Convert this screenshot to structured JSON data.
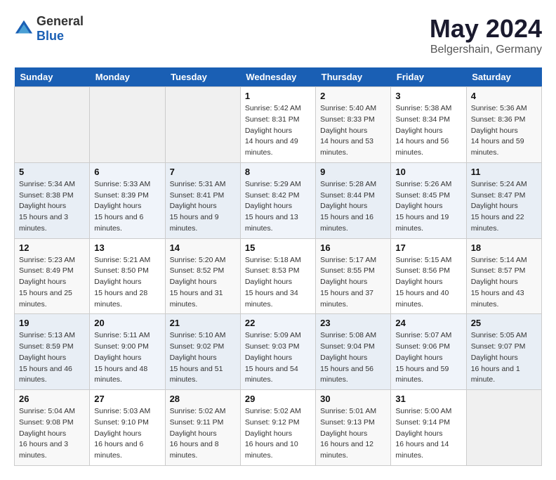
{
  "header": {
    "logo": {
      "general": "General",
      "blue": "Blue"
    },
    "title": "May 2024",
    "location": "Belgershain, Germany"
  },
  "calendar": {
    "weekdays": [
      "Sunday",
      "Monday",
      "Tuesday",
      "Wednesday",
      "Thursday",
      "Friday",
      "Saturday"
    ],
    "weeks": [
      [
        {
          "day": null,
          "info": null
        },
        {
          "day": null,
          "info": null
        },
        {
          "day": null,
          "info": null
        },
        {
          "day": "1",
          "sunrise": "5:42 AM",
          "sunset": "8:31 PM",
          "daylight": "14 hours and 49 minutes."
        },
        {
          "day": "2",
          "sunrise": "5:40 AM",
          "sunset": "8:33 PM",
          "daylight": "14 hours and 53 minutes."
        },
        {
          "day": "3",
          "sunrise": "5:38 AM",
          "sunset": "8:34 PM",
          "daylight": "14 hours and 56 minutes."
        },
        {
          "day": "4",
          "sunrise": "5:36 AM",
          "sunset": "8:36 PM",
          "daylight": "14 hours and 59 minutes."
        }
      ],
      [
        {
          "day": "5",
          "sunrise": "5:34 AM",
          "sunset": "8:38 PM",
          "daylight": "15 hours and 3 minutes."
        },
        {
          "day": "6",
          "sunrise": "5:33 AM",
          "sunset": "8:39 PM",
          "daylight": "15 hours and 6 minutes."
        },
        {
          "day": "7",
          "sunrise": "5:31 AM",
          "sunset": "8:41 PM",
          "daylight": "15 hours and 9 minutes."
        },
        {
          "day": "8",
          "sunrise": "5:29 AM",
          "sunset": "8:42 PM",
          "daylight": "15 hours and 13 minutes."
        },
        {
          "day": "9",
          "sunrise": "5:28 AM",
          "sunset": "8:44 PM",
          "daylight": "15 hours and 16 minutes."
        },
        {
          "day": "10",
          "sunrise": "5:26 AM",
          "sunset": "8:45 PM",
          "daylight": "15 hours and 19 minutes."
        },
        {
          "day": "11",
          "sunrise": "5:24 AM",
          "sunset": "8:47 PM",
          "daylight": "15 hours and 22 minutes."
        }
      ],
      [
        {
          "day": "12",
          "sunrise": "5:23 AM",
          "sunset": "8:49 PM",
          "daylight": "15 hours and 25 minutes."
        },
        {
          "day": "13",
          "sunrise": "5:21 AM",
          "sunset": "8:50 PM",
          "daylight": "15 hours and 28 minutes."
        },
        {
          "day": "14",
          "sunrise": "5:20 AM",
          "sunset": "8:52 PM",
          "daylight": "15 hours and 31 minutes."
        },
        {
          "day": "15",
          "sunrise": "5:18 AM",
          "sunset": "8:53 PM",
          "daylight": "15 hours and 34 minutes."
        },
        {
          "day": "16",
          "sunrise": "5:17 AM",
          "sunset": "8:55 PM",
          "daylight": "15 hours and 37 minutes."
        },
        {
          "day": "17",
          "sunrise": "5:15 AM",
          "sunset": "8:56 PM",
          "daylight": "15 hours and 40 minutes."
        },
        {
          "day": "18",
          "sunrise": "5:14 AM",
          "sunset": "8:57 PM",
          "daylight": "15 hours and 43 minutes."
        }
      ],
      [
        {
          "day": "19",
          "sunrise": "5:13 AM",
          "sunset": "8:59 PM",
          "daylight": "15 hours and 46 minutes."
        },
        {
          "day": "20",
          "sunrise": "5:11 AM",
          "sunset": "9:00 PM",
          "daylight": "15 hours and 48 minutes."
        },
        {
          "day": "21",
          "sunrise": "5:10 AM",
          "sunset": "9:02 PM",
          "daylight": "15 hours and 51 minutes."
        },
        {
          "day": "22",
          "sunrise": "5:09 AM",
          "sunset": "9:03 PM",
          "daylight": "15 hours and 54 minutes."
        },
        {
          "day": "23",
          "sunrise": "5:08 AM",
          "sunset": "9:04 PM",
          "daylight": "15 hours and 56 minutes."
        },
        {
          "day": "24",
          "sunrise": "5:07 AM",
          "sunset": "9:06 PM",
          "daylight": "15 hours and 59 minutes."
        },
        {
          "day": "25",
          "sunrise": "5:05 AM",
          "sunset": "9:07 PM",
          "daylight": "16 hours and 1 minute."
        }
      ],
      [
        {
          "day": "26",
          "sunrise": "5:04 AM",
          "sunset": "9:08 PM",
          "daylight": "16 hours and 3 minutes."
        },
        {
          "day": "27",
          "sunrise": "5:03 AM",
          "sunset": "9:10 PM",
          "daylight": "16 hours and 6 minutes."
        },
        {
          "day": "28",
          "sunrise": "5:02 AM",
          "sunset": "9:11 PM",
          "daylight": "16 hours and 8 minutes."
        },
        {
          "day": "29",
          "sunrise": "5:02 AM",
          "sunset": "9:12 PM",
          "daylight": "16 hours and 10 minutes."
        },
        {
          "day": "30",
          "sunrise": "5:01 AM",
          "sunset": "9:13 PM",
          "daylight": "16 hours and 12 minutes."
        },
        {
          "day": "31",
          "sunrise": "5:00 AM",
          "sunset": "9:14 PM",
          "daylight": "16 hours and 14 minutes."
        },
        {
          "day": null,
          "info": null
        }
      ]
    ]
  },
  "labels": {
    "sunrise": "Sunrise:",
    "sunset": "Sunset:",
    "daylight": "Daylight hours"
  }
}
